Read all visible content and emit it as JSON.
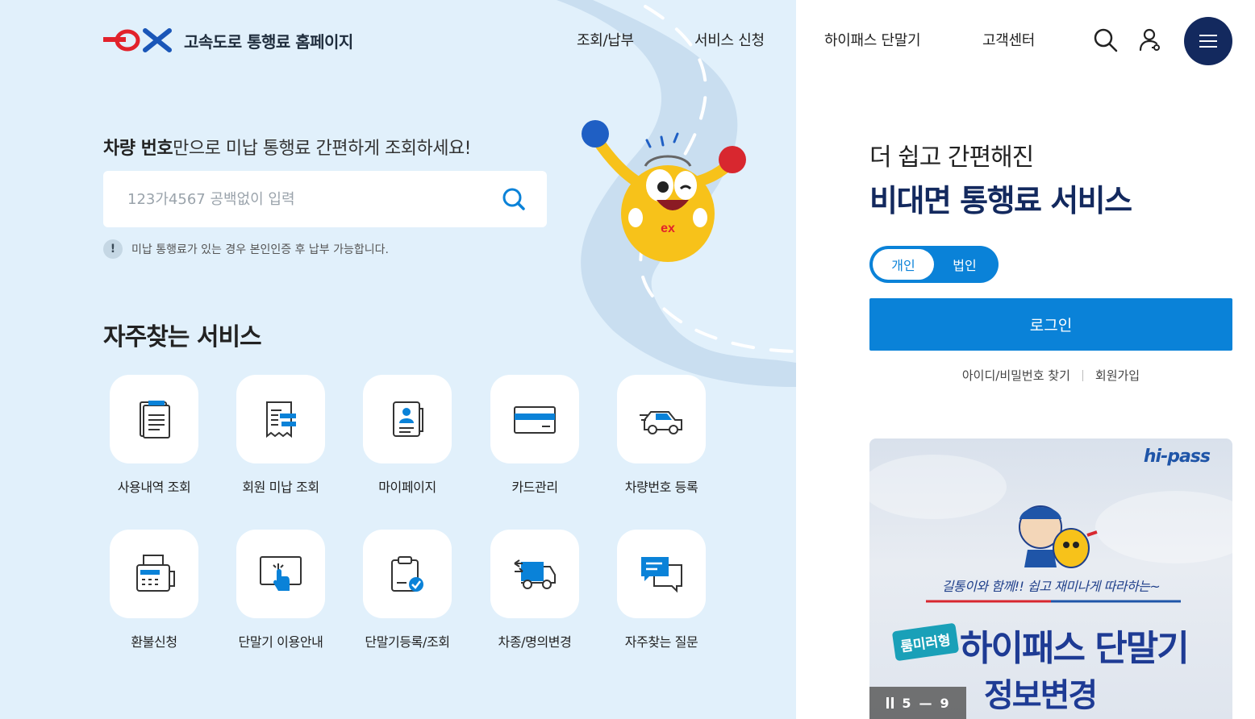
{
  "header": {
    "logo_text": "고속도로 통행료 홈페이지",
    "nav": [
      "조회/납부",
      "서비스 신청",
      "하이패스 단말기",
      "고객센터"
    ],
    "icons": [
      "search-icon",
      "user-icon",
      "hamburger-menu-icon"
    ],
    "accent_color": "#13295e"
  },
  "lookup": {
    "title_bold": "차량 번호",
    "title_rest": "만으로 미납 통행료 간편하게 조회하세요!",
    "placeholder": "123가4567 공백없이 입력",
    "notice_icon": "!",
    "notice": "미납 통행료가 있는 경우 본인인증 후 납부 가능합니다."
  },
  "services": {
    "title": "자주찾는 서비스",
    "items": [
      {
        "label": "사용내역 조회",
        "icon": "receipt-list-icon"
      },
      {
        "label": "회원 미납 조회",
        "icon": "bill-icon"
      },
      {
        "label": "마이페이지",
        "icon": "profile-card-icon"
      },
      {
        "label": "카드관리",
        "icon": "credit-card-icon"
      },
      {
        "label": "차량번호 등록",
        "icon": "car-icon"
      },
      {
        "label": "환불신청",
        "icon": "cash-register-icon"
      },
      {
        "label": "단말기 이용안내",
        "icon": "touch-screen-icon"
      },
      {
        "label": "단말기등록/조회",
        "icon": "clipboard-check-icon"
      },
      {
        "label": "차종/명의변경",
        "icon": "truck-exchange-icon"
      },
      {
        "label": "자주찾는 질문",
        "icon": "chat-bubbles-icon"
      }
    ]
  },
  "promo": {
    "sub": "더 쉽고 간편해진",
    "main": "비대면 통행료 서비스",
    "toggle": {
      "personal": "개인",
      "corporate": "법인"
    },
    "login": "로그인",
    "find_id": "아이디/비밀번호 찾기",
    "signup": "회원가입",
    "primary_color": "#0a82d8"
  },
  "banner": {
    "brand": "hi-pass",
    "tagline": "길통이와 함께!! 쉽고 재미나게 따라하는~",
    "badge": "룸미러형",
    "headline": "하이패스 단말기",
    "subheadline": "정보변경",
    "slide_current": "5",
    "slide_sep": "—",
    "slide_total": "9"
  }
}
